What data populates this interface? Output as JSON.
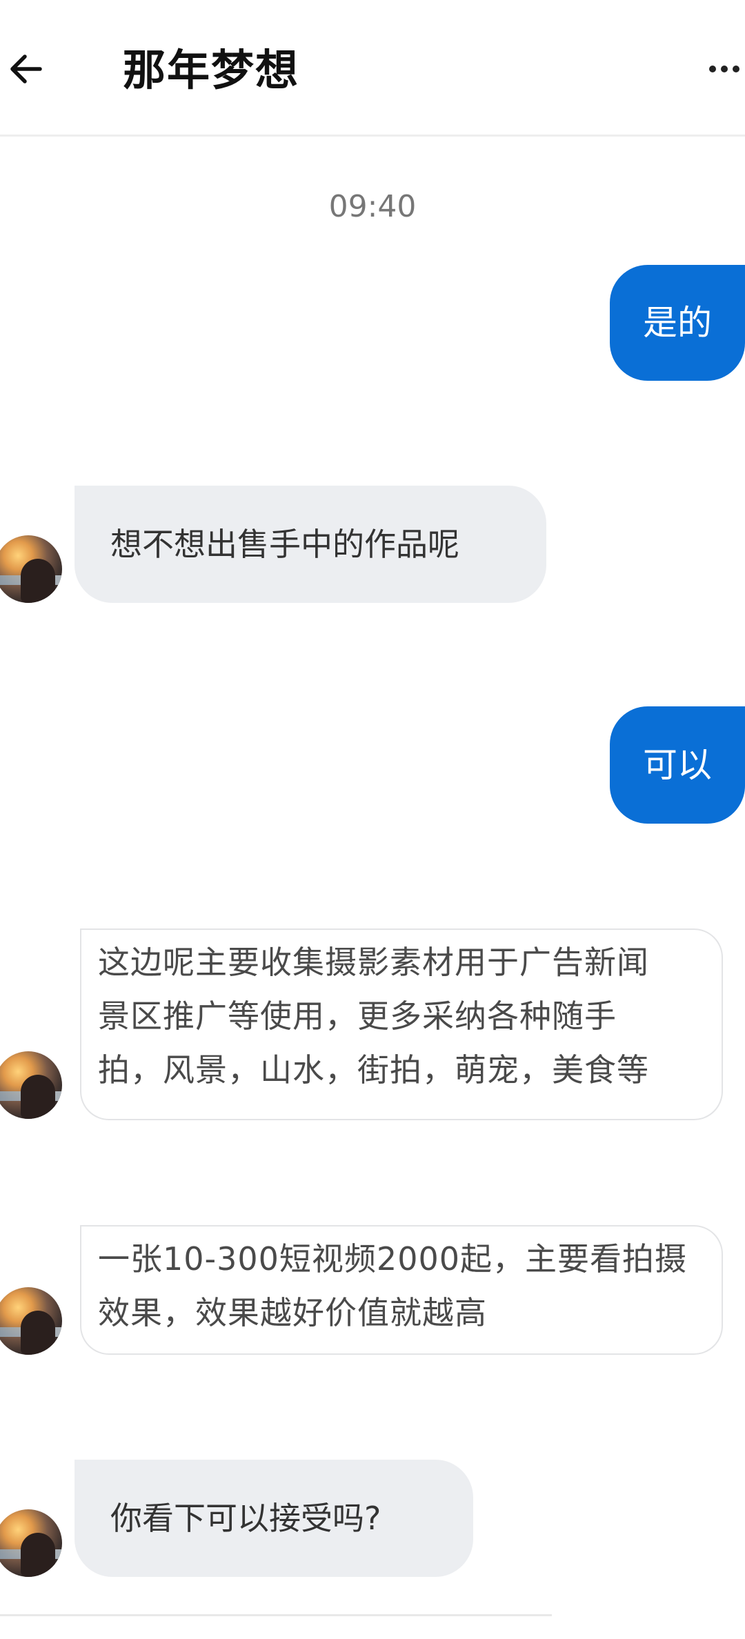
{
  "header": {
    "title": "那年梦想"
  },
  "conversation": {
    "timestamp": "09:40",
    "messages": [
      {
        "id": "m1",
        "direction": "outgoing",
        "text": "是的"
      },
      {
        "id": "m2",
        "direction": "incoming",
        "text": "想不想出售手中的作品呢"
      },
      {
        "id": "m3",
        "direction": "outgoing",
        "text": "可以"
      },
      {
        "id": "m4",
        "direction": "incoming",
        "lines": [
          "这边呢主要收集摄影素材用于广告新闻",
          "景区推广等使用，更多采纳各种随手",
          "拍，风景，山水，街拍，萌宠，美食等"
        ]
      },
      {
        "id": "m5",
        "direction": "incoming",
        "lines": [
          "一张10-300短视频2000起，主要看拍摄",
          "效果，效果越好价值就越高"
        ]
      },
      {
        "id": "m6",
        "direction": "incoming",
        "text": "你看下可以接受吗?"
      }
    ]
  },
  "colors": {
    "outgoing_bubble": "#0a6fd6",
    "incoming_bubble": "#eceef1",
    "background": "#ffffff"
  },
  "icons": {
    "back": "arrow-left-icon",
    "more": "more-dots-icon"
  }
}
